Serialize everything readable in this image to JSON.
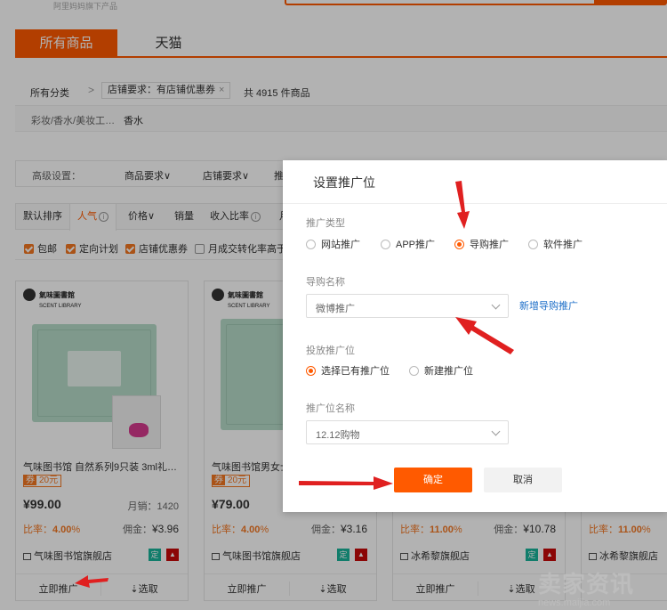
{
  "header": {
    "slogan": "阿里妈妈旗下产品"
  },
  "tabs": [
    {
      "label": "所有商品"
    },
    {
      "label": "天猫"
    }
  ],
  "filters": {
    "crumb_label": "所有分类",
    "crumb_sep": ">",
    "crumb_tag": "店铺要求：有店铺优惠券",
    "crumb_close": "×",
    "count": "共 4915 件商品",
    "category_name": "彩妆/香水/美妆工…",
    "category_value": "香水",
    "advanced_label": "高级设置：",
    "advanced_options": [
      "商品要求∨",
      "店铺要求∨",
      "推"
    ]
  },
  "sort": [
    "默认排序",
    "人气",
    "价格∨",
    "销量",
    "收入比率",
    "月"
  ],
  "checks": [
    {
      "label": "包邮",
      "checked": true
    },
    {
      "label": "定向计划",
      "checked": true
    },
    {
      "label": "店铺优惠券",
      "checked": true
    },
    {
      "label": "月成交转化率高于",
      "checked": false
    }
  ],
  "products": [
    {
      "brand": "氣味圖書館",
      "brand_en": "SCENT LIBRARY",
      "title": "气味图书馆 自然系列9只装 3ml礼…",
      "coupon_tag": "券",
      "coupon_value": "20元",
      "price": "¥99.00",
      "sales": "月销：1420",
      "rate_prefix": "比率：",
      "rate": "4.00",
      "rate_suffix": "%",
      "commission_prefix": "佣金：",
      "commission": "¥3.96",
      "shop": "气味图书馆旗舰店",
      "badge": "定",
      "footer_left": "立即推广",
      "footer_right": "⇣选取"
    },
    {
      "brand": "氣味圖書館",
      "brand_en": "SCENT LIBRARY",
      "title": "气味图书馆男女士…",
      "coupon_tag": "券",
      "coupon_value": "20元",
      "price": "¥79.00",
      "sales": "",
      "rate_prefix": "比率：",
      "rate": "4.00",
      "rate_suffix": "%",
      "commission_prefix": "佣金：",
      "commission": "¥3.16",
      "shop": "气味图书馆旗舰店",
      "badge": "定",
      "footer_left": "立即推广",
      "footer_right": "⇣选取"
    },
    {
      "rate_prefix": "比率：",
      "rate": "11.00",
      "rate_suffix": "%",
      "commission_prefix": "佣金：",
      "commission": "¥10.78",
      "shop": "冰希黎旗舰店",
      "badge": "定",
      "footer_left": "立即推广",
      "footer_right": "⇣选取"
    },
    {
      "rate_prefix": "比率：",
      "rate": "11.00",
      "rate_suffix": "%",
      "shop": "冰希黎旗舰店"
    }
  ],
  "modal": {
    "title": "设置推广位",
    "type_label": "推广类型",
    "type_options": [
      {
        "label": "网站推广",
        "selected": false
      },
      {
        "label": "APP推广",
        "selected": false
      },
      {
        "label": "导购推广",
        "selected": true
      },
      {
        "label": "软件推广",
        "selected": false
      }
    ],
    "guide_label": "导购名称",
    "guide_select": "微博推广",
    "guide_link": "新增导购推广",
    "position_label": "投放推广位",
    "position_options": [
      {
        "label": "选择已有推广位",
        "selected": true
      },
      {
        "label": "新建推广位",
        "selected": false
      }
    ],
    "position_name_label": "推广位名称",
    "position_name_select": "12.12购物",
    "ok": "确定",
    "cancel": "取消"
  },
  "watermark": {
    "main": "卖家资讯",
    "sub": "news.maijia.com"
  },
  "colors": {
    "accent": "#ff5a00",
    "link": "#1e6fc8",
    "arrow": "#e02020"
  }
}
